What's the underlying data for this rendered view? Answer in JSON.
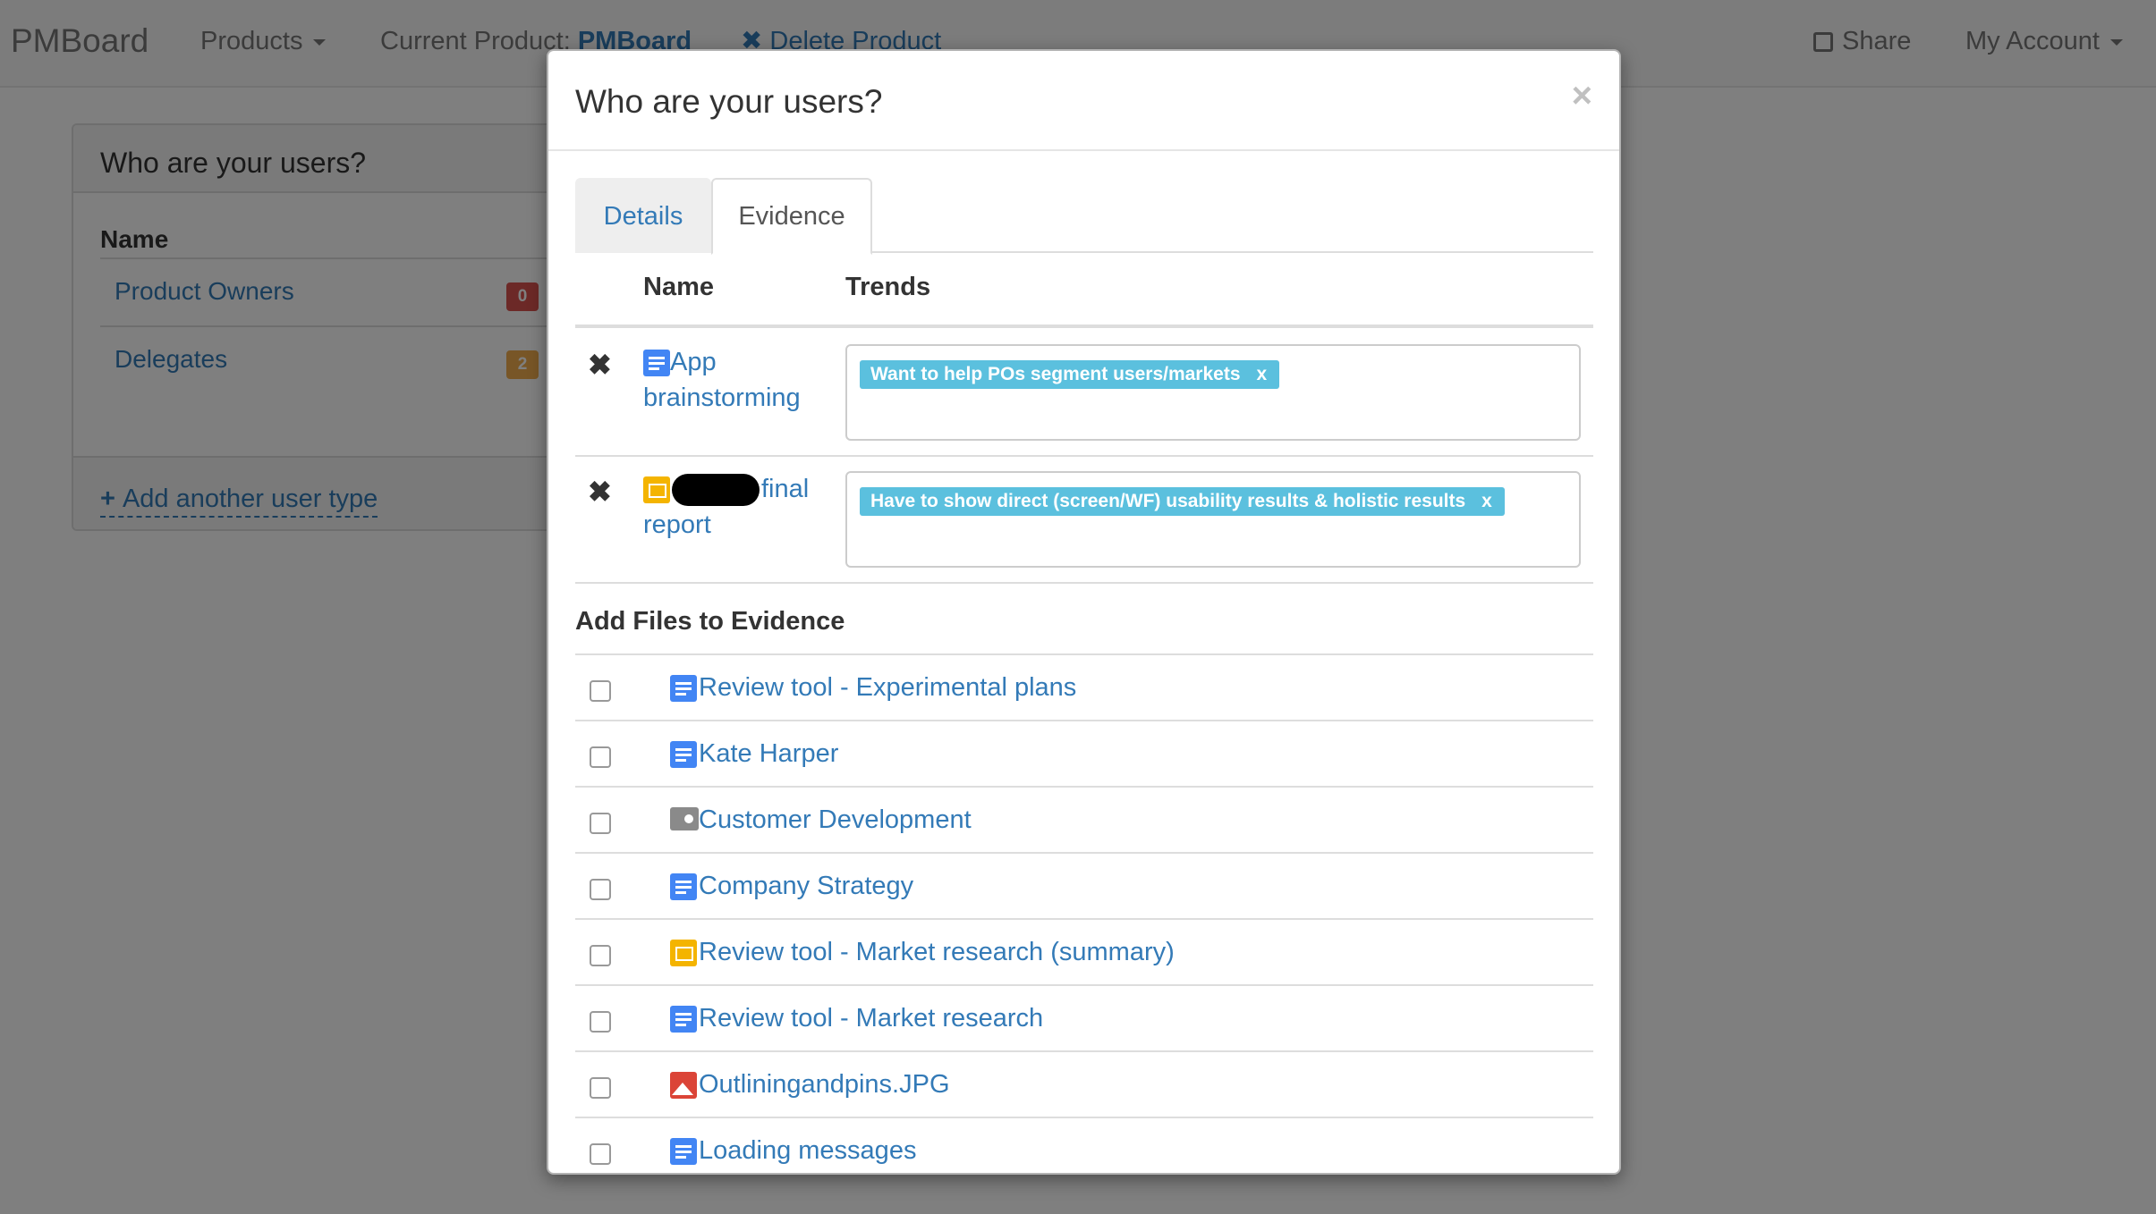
{
  "navbar": {
    "brand": "PMBoard",
    "products": "Products",
    "current_product_label": "Current Product:",
    "current_product_name": "PMBoard",
    "delete_product": "Delete Product",
    "share": "Share",
    "my_account": "My Account",
    "delete_icon": "✖",
    "share_icon": "share-icon"
  },
  "panel": {
    "title": "Who are your users?",
    "col_name": "Name",
    "rows": [
      {
        "label": "Product Owners",
        "badge": "0",
        "badge_color": "#d9534f"
      },
      {
        "label": "Delegates",
        "badge": "2",
        "badge_color": "#f0ad4e"
      }
    ],
    "add_user_type": "Add another user type"
  },
  "modal": {
    "title": "Who are your users?",
    "close": "×",
    "tabs": [
      {
        "label": "Details",
        "active": false
      },
      {
        "label": "Evidence",
        "active": true
      }
    ],
    "evidence": {
      "col_name": "Name",
      "col_trends": "Trends",
      "rows": [
        {
          "remove": "✖",
          "icon": "doc-icon",
          "name": "App brainstorming",
          "trend": "Want to help POs segment users/markets",
          "trend_remove": "x"
        },
        {
          "remove": "✖",
          "icon": "slides-icon",
          "name_suffix": "final report",
          "trend": "Have to show direct (screen/WF) usability results & holistic results",
          "trend_remove": "x"
        }
      ]
    },
    "add_files_title": "Add Files to Evidence",
    "files": [
      {
        "icon": "doc-icon",
        "name": "Review tool - Experimental plans"
      },
      {
        "icon": "doc-icon",
        "name": "Kate Harper"
      },
      {
        "icon": "shared-folder-icon",
        "name": "Customer Development"
      },
      {
        "icon": "doc-icon",
        "name": "Company Strategy"
      },
      {
        "icon": "slides-icon",
        "name": "Review tool - Market research (summary)"
      },
      {
        "icon": "doc-icon",
        "name": "Review tool - Market research"
      },
      {
        "icon": "image-icon",
        "name": "Outliningandpins.JPG"
      },
      {
        "icon": "doc-icon",
        "name": "Loading messages"
      }
    ]
  }
}
